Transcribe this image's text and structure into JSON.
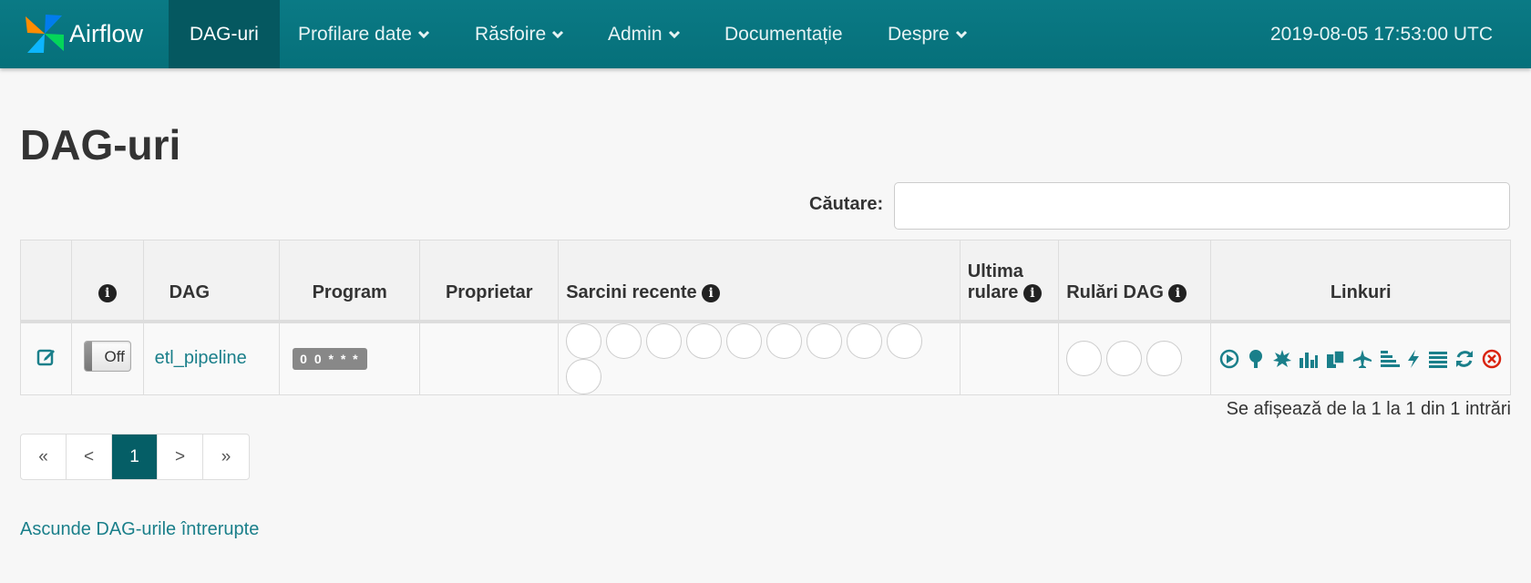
{
  "navbar": {
    "brand": "Airflow",
    "items": [
      {
        "label": "DAG-uri",
        "active": true,
        "dropdown": false
      },
      {
        "label": "Profilare date",
        "dropdown": true
      },
      {
        "label": "Răsfoire",
        "dropdown": true
      },
      {
        "label": "Admin",
        "dropdown": true
      },
      {
        "label": "Documentație",
        "dropdown": false
      },
      {
        "label": "Despre",
        "dropdown": true
      }
    ],
    "clock": "2019-08-05 17:53:00 UTC"
  },
  "page": {
    "title": "DAG-uri",
    "search_label": "Căutare:",
    "search_value": ""
  },
  "table": {
    "headers": {
      "dag": "DAG",
      "schedule": "Program",
      "owner": "Proprietar",
      "recent_tasks": "Sarcini recente",
      "last_run_line1": "Ultima",
      "last_run_line2": "rulare",
      "dag_runs": "Rulări DAG",
      "links": "Linkuri"
    },
    "rows": [
      {
        "toggle": "Off",
        "dag_id": "etl_pipeline",
        "schedule": "0 0 * * *",
        "owner": "",
        "recent_task_circles": 10,
        "last_run": "",
        "dag_run_circles": 3
      }
    ]
  },
  "entries_info": "Se afișează de la 1 la 1 din 1 intrări",
  "pagination": [
    "«",
    "<",
    "1",
    ">",
    "»"
  ],
  "pagination_active": "1",
  "hide_paused_link": "Ascunde DAG-urile întrerupte",
  "colors": {
    "navbar": "#0a7a85",
    "nav_active": "#055860",
    "link": "#1a7f8a",
    "delete_icon": "#d9230f"
  },
  "link_icons": [
    "trigger-dag-icon",
    "tree-view-icon",
    "graph-view-icon",
    "task-duration-icon",
    "task-tries-icon",
    "landing-times-icon",
    "gantt-icon",
    "code-view-icon",
    "logs-icon",
    "refresh-icon",
    "delete-icon"
  ]
}
